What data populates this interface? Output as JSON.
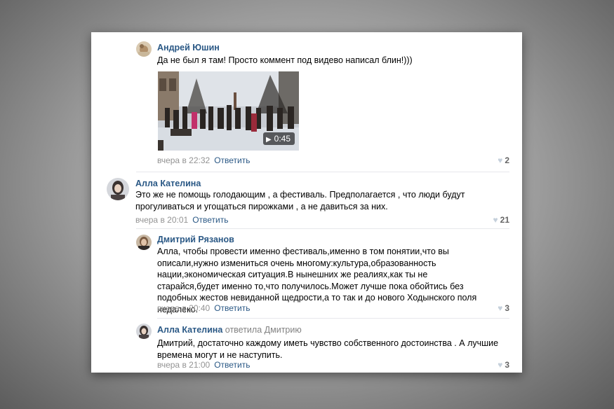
{
  "comments": [
    {
      "author": "Андрей Юшин",
      "text": "Да не был я там! Просто коммент под видево написал блин!)))",
      "video_duration": "0:45",
      "time": "вчера в 22:32",
      "reply_label": "Ответить",
      "likes": "2"
    },
    {
      "author": "Алла Кателина",
      "text": "Это же не помощь голодающим , а фестиваль. Предполагается , что люди будут прогуливаться и угощаться пирожками , а не давиться за них.",
      "time": "вчера в 20:01",
      "reply_label": "Ответить",
      "likes": "21"
    },
    {
      "author": "Дмитрий Рязанов",
      "text": "Алла, чтобы провести именно фестиваль,именно в том понятии,что вы описали,нужно измениться очень многому:культура,образованность нации,экономическая ситуация.В нынешних же реалиях,как ты не старайся,будет именно то,что получилось.Может лучше пока обойтись без подобных жестов невиданной щедрости,а то так и до нового Ходынского поля недалеко.",
      "time": "вчера в 20:40",
      "reply_label": "Ответить",
      "likes": "3"
    },
    {
      "author": "Алла Кателина",
      "reply_word": "ответила",
      "reply_to": "Дмитрию",
      "text": "Дмитрий, достаточно каждому иметь чувство собственного достоинства . А лучшие времена могут и не наступить.",
      "time": "вчера в 21:00",
      "reply_label": "Ответить",
      "likes": "3"
    }
  ],
  "icons": {
    "like": "heart-icon",
    "play": "play-icon"
  },
  "colors": {
    "link": "#2a5885",
    "meta": "#939393",
    "separator": "#e7e8ec"
  }
}
